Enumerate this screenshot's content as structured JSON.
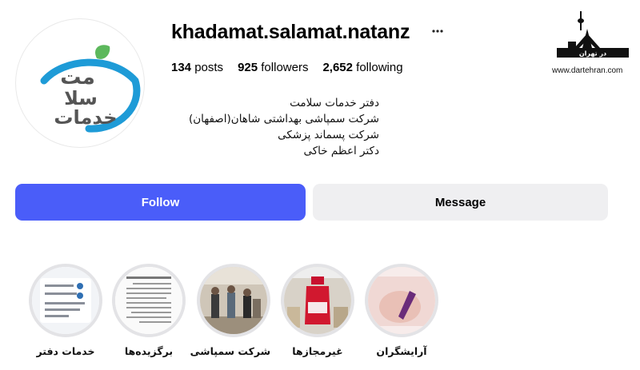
{
  "profile": {
    "username": "khadamat.salamat.natanz",
    "more_icon": "more-horizontal-icon",
    "avatar_logo_text_top": "مت",
    "avatar_logo_text_mid": "سلا",
    "avatar_logo_text_bottom": "خدمات",
    "stats": {
      "posts_count": "134",
      "posts_label": "posts",
      "followers_count": "925",
      "followers_label": "followers",
      "following_count": "2,652",
      "following_label": "following"
    },
    "bio": [
      "دفتر خدمات سلامت",
      "شرکت سمپاشی بهداشتی شاهان(اصفهان)",
      "شرکت پسماند پزشکی",
      "دکتر اعظم خاکی"
    ]
  },
  "actions": {
    "follow_label": "Follow",
    "message_label": "Message"
  },
  "highlights": [
    {
      "label": "خدمات دفتر"
    },
    {
      "label": "برگزیده‌ها"
    },
    {
      "label": "شرکت سمپاشی"
    },
    {
      "label": "غیرمجازها"
    },
    {
      "label": "آرایشگران"
    }
  ],
  "watermark": {
    "brand_text": "در تهران",
    "url": "www.dartehran.com"
  },
  "colors": {
    "follow_bg": "#4a5df9",
    "message_bg": "#efeff1",
    "logo_blue": "#1e9bd7",
    "logo_green": "#5cb85c"
  }
}
